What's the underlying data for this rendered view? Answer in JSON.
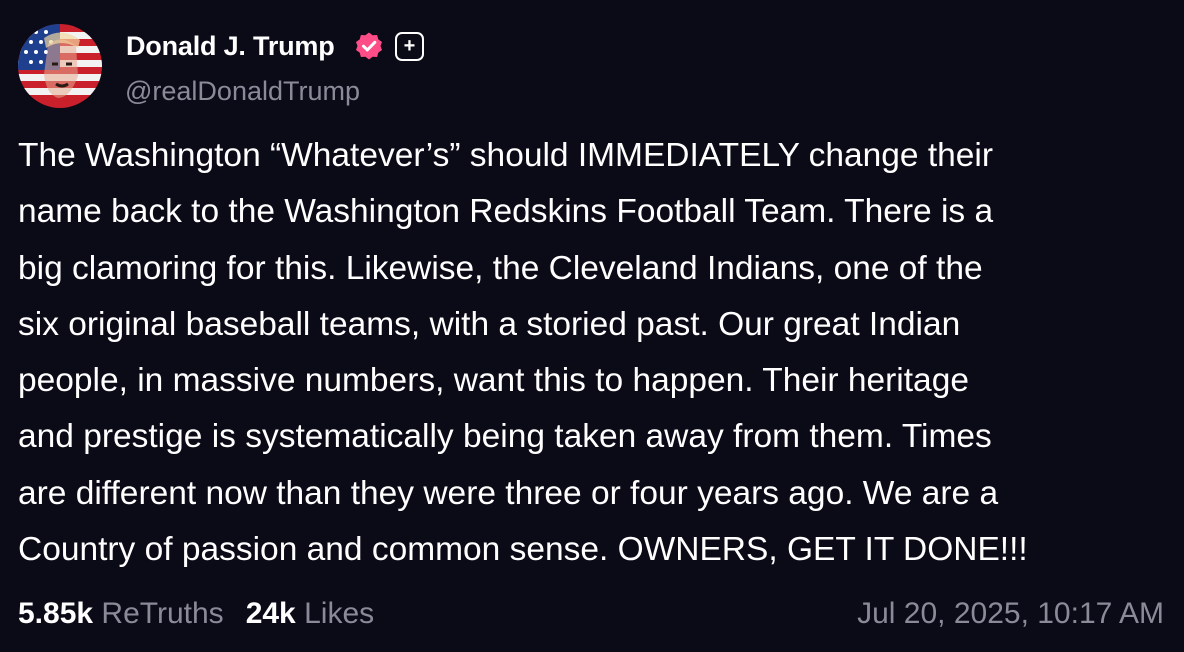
{
  "author": {
    "display_name": "Donald J. Trump",
    "handle": "@realDonaldTrump",
    "verified": true,
    "verified_color": "#ff4d88",
    "plus_badge": "+"
  },
  "post": {
    "lines": [
      "The Washington “Whatever’s” should IMMEDIATELY change their",
      "name back to the Washington Redskins Football Team. There is a",
      "big clamoring for this. Likewise, the Cleveland Indians, one of the",
      "six original baseball teams, with a storied past. Our great Indian",
      "people, in massive numbers, want this to happen. Their heritage",
      "and prestige is systematically being taken away from them. Times",
      "are different now than they were three or four years ago. We are a",
      "Country of passion and common sense. OWNERS, GET IT DONE!!!"
    ]
  },
  "stats": {
    "retruths_count": "5.85k",
    "retruths_label": "ReTruths",
    "likes_count": "24k",
    "likes_label": "Likes"
  },
  "timestamp": "Jul 20, 2025, 10:17 AM",
  "colors": {
    "background": "#0b0a17",
    "primary_text": "#ffffff",
    "secondary_text": "#8a8b99"
  }
}
